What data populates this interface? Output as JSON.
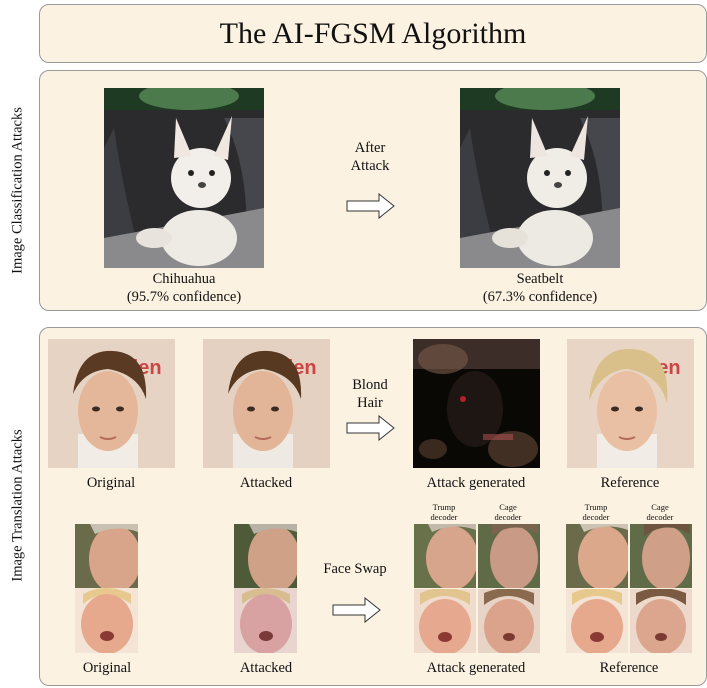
{
  "title": "The AI-FGSM Algorithm",
  "classification": {
    "side_label": "Image Classification Attacks",
    "arrow_label_line1": "After",
    "arrow_label_line2": "Attack",
    "original": {
      "label": "Chihuahua",
      "confidence": "(95.7% confidence)"
    },
    "attacked": {
      "label": "Seatbelt",
      "confidence": "(67.3% confidence)"
    }
  },
  "translation": {
    "side_label": "Image Translation Attacks",
    "row1": {
      "arrow_label_line1": "Blond",
      "arrow_label_line2": "Hair",
      "captions": [
        "Original",
        "Attacked",
        "Attack generated",
        "Reference"
      ]
    },
    "row2": {
      "arrow_label": "Face Swap",
      "decoders": {
        "trump_line1": "Trump",
        "trump_line2": "decoder",
        "cage_line1": "Cage",
        "cage_line2": "decoder"
      },
      "captions": [
        "Original",
        "Attacked",
        "Attack generated",
        "Reference"
      ]
    }
  }
}
